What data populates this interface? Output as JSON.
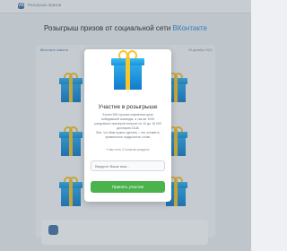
{
  "header": {
    "logo_text": "VK",
    "title": "Розыгрыш призов"
  },
  "page": {
    "title_prefix": "Розыгрыш призов от социальной сети ",
    "title_accent": "ВКонтакте"
  },
  "post": {
    "group_name": "ВКонтакте новости",
    "date": "30 декабря 2021"
  },
  "modal": {
    "title": "Участие в розыгрыше",
    "text1": "Более 500 лучших комментаторов победившей команды, а так же 1000 рандомных призеров получат по 10 до 15 000 долларов США",
    "text2": "Все, что Вам нужно сделать – это оставить правильное подарочное слово",
    "text3": "У вас есть 3 попытки угадать!",
    "input_placeholder": "Введите Ваше имя...",
    "button_label": "Принять участие"
  },
  "colors": {
    "accent": "#2f8fe0",
    "button": "#4bb34b",
    "gift": "#1a8fd6",
    "ribbon": "#f6c42d"
  },
  "icons": {
    "header_logo": "vk-logo-icon",
    "gift": "gift-box-icon"
  }
}
